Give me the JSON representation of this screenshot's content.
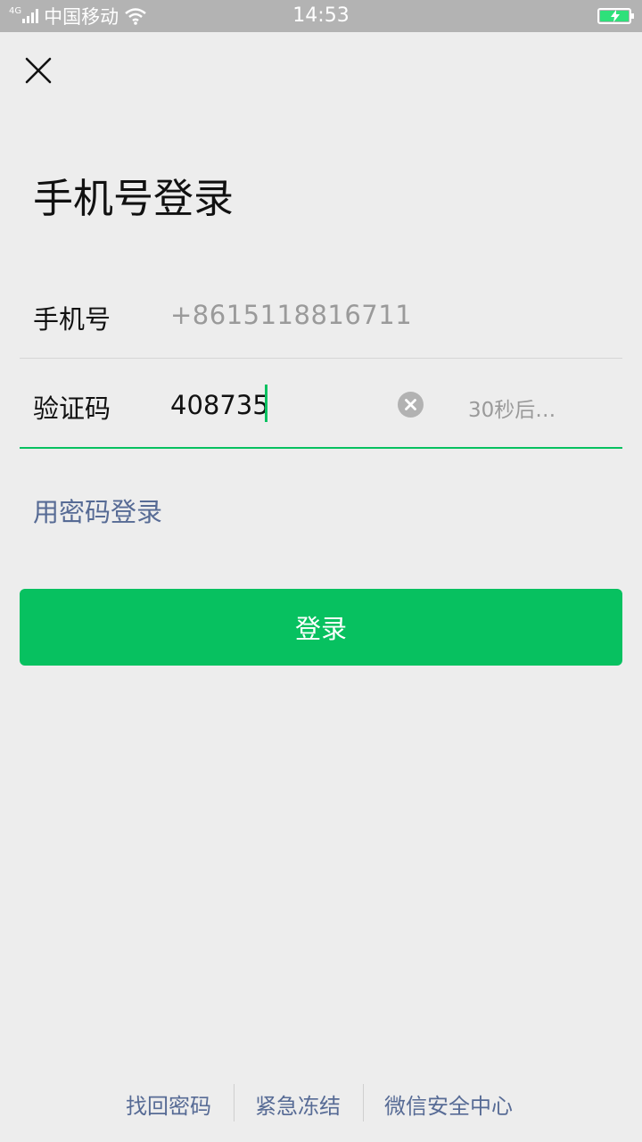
{
  "status_bar": {
    "network": "4G",
    "carrier": "中国移动",
    "time": "14:53"
  },
  "page": {
    "title": "手机号登录"
  },
  "phone_field": {
    "label": "手机号",
    "value": "+8615118816711"
  },
  "code_field": {
    "label": "验证码",
    "value": "408735",
    "countdown": "30秒后…"
  },
  "password_login_link": "用密码登录",
  "login_button": "登录",
  "footer": {
    "links": [
      "找回密码",
      "紧急冻结",
      "微信安全中心"
    ]
  },
  "colors": {
    "accent": "#07c160",
    "link": "#576b95",
    "background": "#ededed",
    "status_bar": "#b3b3b3"
  },
  "icons": {
    "close": "close-icon",
    "clear": "clear-input-icon",
    "wifi": "wifi-icon",
    "battery": "battery-charging-icon",
    "signal": "signal-icon"
  }
}
